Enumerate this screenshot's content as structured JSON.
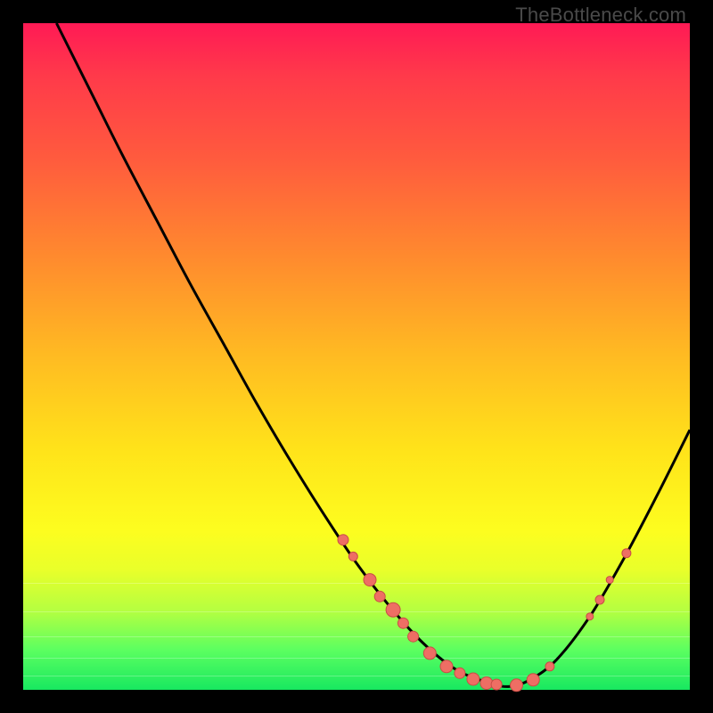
{
  "attribution": "TheBottleneck.com",
  "colors": {
    "dot_fill": "#ee6e64",
    "dot_stroke": "#c94d45",
    "curve_stroke": "#000000"
  },
  "chart_data": {
    "type": "line",
    "title": "",
    "xlabel": "",
    "ylabel": "",
    "xlim": [
      0,
      100
    ],
    "ylim": [
      0,
      100
    ],
    "grid": false,
    "curve_points": [
      {
        "x": 5.0,
        "y": 100.0
      },
      {
        "x": 10.0,
        "y": 90.0
      },
      {
        "x": 15.0,
        "y": 80.0
      },
      {
        "x": 20.0,
        "y": 70.5
      },
      {
        "x": 25.0,
        "y": 61.0
      },
      {
        "x": 30.0,
        "y": 52.0
      },
      {
        "x": 35.0,
        "y": 43.0
      },
      {
        "x": 40.0,
        "y": 34.5
      },
      {
        "x": 45.0,
        "y": 26.5
      },
      {
        "x": 50.0,
        "y": 19.0
      },
      {
        "x": 55.0,
        "y": 12.5
      },
      {
        "x": 60.0,
        "y": 7.0
      },
      {
        "x": 65.0,
        "y": 3.0
      },
      {
        "x": 70.0,
        "y": 1.0
      },
      {
        "x": 73.0,
        "y": 0.5
      },
      {
        "x": 76.0,
        "y": 1.5
      },
      {
        "x": 80.0,
        "y": 4.5
      },
      {
        "x": 85.0,
        "y": 11.0
      },
      {
        "x": 90.0,
        "y": 19.5
      },
      {
        "x": 95.0,
        "y": 29.0
      },
      {
        "x": 100.0,
        "y": 39.0
      }
    ],
    "highlight_dots": [
      {
        "x": 48.0,
        "y": 22.5,
        "r": 6
      },
      {
        "x": 49.5,
        "y": 20.0,
        "r": 5
      },
      {
        "x": 52.0,
        "y": 16.5,
        "r": 7
      },
      {
        "x": 53.5,
        "y": 14.0,
        "r": 6
      },
      {
        "x": 55.5,
        "y": 12.0,
        "r": 8
      },
      {
        "x": 57.0,
        "y": 10.0,
        "r": 6
      },
      {
        "x": 58.5,
        "y": 8.0,
        "r": 6
      },
      {
        "x": 61.0,
        "y": 5.5,
        "r": 7
      },
      {
        "x": 63.5,
        "y": 3.5,
        "r": 7
      },
      {
        "x": 65.5,
        "y": 2.5,
        "r": 6
      },
      {
        "x": 67.5,
        "y": 1.6,
        "r": 7
      },
      {
        "x": 69.5,
        "y": 1.0,
        "r": 7
      },
      {
        "x": 71.0,
        "y": 0.8,
        "r": 6
      },
      {
        "x": 74.0,
        "y": 0.7,
        "r": 7
      },
      {
        "x": 76.5,
        "y": 1.5,
        "r": 7
      },
      {
        "x": 79.0,
        "y": 3.5,
        "r": 5
      },
      {
        "x": 85.0,
        "y": 11.0,
        "r": 4
      },
      {
        "x": 86.5,
        "y": 13.5,
        "r": 5
      },
      {
        "x": 88.0,
        "y": 16.5,
        "r": 4
      },
      {
        "x": 90.5,
        "y": 20.5,
        "r": 5
      }
    ]
  }
}
